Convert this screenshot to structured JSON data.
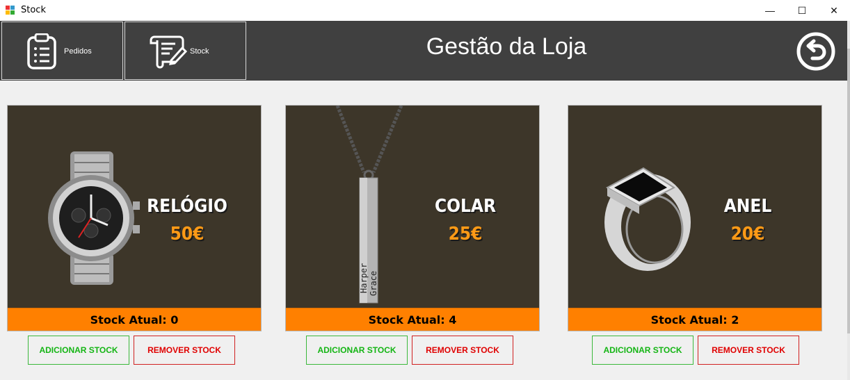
{
  "window": {
    "title": "Stock",
    "minimize": "—",
    "maximize": "☐",
    "close": "✕"
  },
  "nav": {
    "orders_label": "Pedidos",
    "stock_label": "Stock"
  },
  "header": {
    "title": "Gestão da Loja"
  },
  "products": [
    {
      "name": "RELÓGIO",
      "price": "50€",
      "stock": "Stock Atual: 0"
    },
    {
      "name": "COLAR",
      "price": "25€",
      "stock": "Stock Atual: 4"
    },
    {
      "name": "ANEL",
      "price": "20€",
      "stock": "Stock Atual: 2"
    }
  ],
  "actions": {
    "add": "ADICIONAR STOCK",
    "remove": "REMOVER STOCK"
  },
  "engraving": {
    "line1": "Harper",
    "line2": "Grace"
  },
  "colors": {
    "accent": "#ff8000",
    "price": "#ff9a16",
    "header": "#404040",
    "card_bg": "#3d3629",
    "add": "#14b514",
    "remove": "#e00000"
  }
}
